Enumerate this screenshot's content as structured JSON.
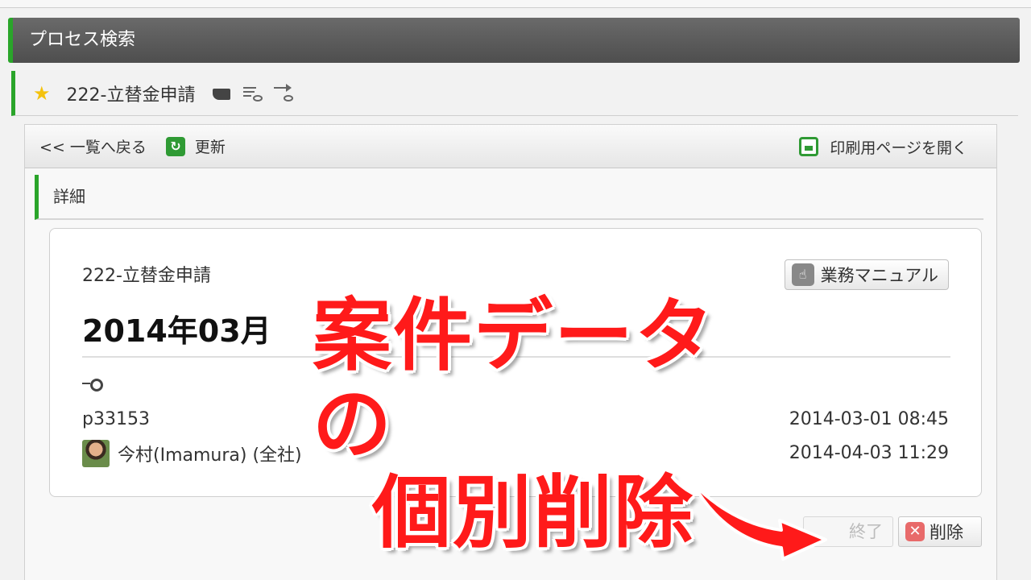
{
  "header": {
    "title": "プロセス検索"
  },
  "process": {
    "name": "222-立替金申請"
  },
  "toolbar": {
    "back": "<< 一覧へ戻る",
    "refresh": "更新",
    "print": "印刷用ページを開く"
  },
  "section": {
    "title": "詳細"
  },
  "card": {
    "process_name": "222-立替金申請",
    "manual_button": "業務マニュアル",
    "title": "2014年03月",
    "id": "p33153",
    "created": "2014-03-01 08:45",
    "user": "今村(Imamura) (全社)",
    "updated": "2014-04-03 11:29"
  },
  "actions": {
    "finish": "終了",
    "delete": "削除"
  },
  "overlay": {
    "line1": "案件データの",
    "line2": "個別削除"
  },
  "colors": {
    "accent_green": "#2aa52a",
    "overlay_red": "#ff1a1a"
  }
}
